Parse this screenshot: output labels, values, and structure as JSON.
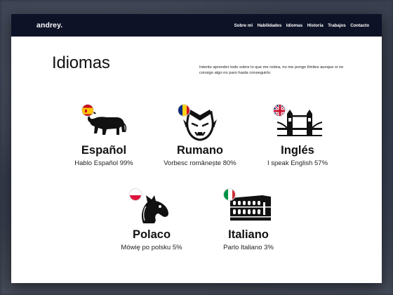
{
  "brand": "andrey.",
  "nav": [
    {
      "label": "Sobre mi"
    },
    {
      "label": "Habilidades"
    },
    {
      "label": "Idiomas"
    },
    {
      "label": "Historia"
    },
    {
      "label": "Trabajos"
    },
    {
      "label": "Contacto"
    }
  ],
  "section": {
    "title": "Idiomas",
    "description": "Intento aprender todo sobre lo que me rodea, no me pongo límites aunque si no consigo algo no paro hasta conseguirlo."
  },
  "languages": [
    {
      "name": "Español",
      "level": "Hablo Español 99%",
      "icon": "bull-icon",
      "flag": "spain-flag-icon",
      "percent": 99
    },
    {
      "name": "Rumano",
      "level": "Vorbesc românește 80%",
      "icon": "vampire-icon",
      "flag": "romania-flag-icon",
      "percent": 80
    },
    {
      "name": "Inglés",
      "level": "I speak English 57%",
      "icon": "tower-bridge-icon",
      "flag": "uk-flag-icon",
      "percent": 57
    },
    {
      "name": "Polaco",
      "level": "Mówię po polsku 5%",
      "icon": "horse-head-icon",
      "flag": "poland-flag-icon",
      "percent": 5
    },
    {
      "name": "Italiano",
      "level": "Parlo Italiano 3%",
      "icon": "colosseum-icon",
      "flag": "italy-flag-icon",
      "percent": 3
    }
  ],
  "colors": {
    "navbar": "#0d1226",
    "text": "#111111",
    "background": "#ffffff"
  }
}
